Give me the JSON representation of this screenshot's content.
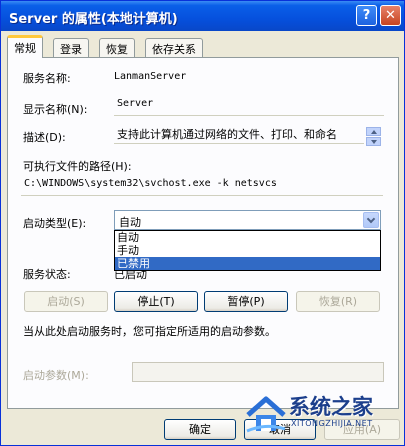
{
  "window": {
    "title": "Server 的属性(本地计算机)",
    "help_glyph": "?",
    "close_glyph": "✕"
  },
  "tabs": [
    {
      "label": "常规",
      "active": true
    },
    {
      "label": "登录",
      "active": false
    },
    {
      "label": "恢复",
      "active": false
    },
    {
      "label": "依存关系",
      "active": false
    }
  ],
  "general": {
    "service_name_label": "服务名称:",
    "service_name_value": "LanmanServer",
    "display_name_label": "显示名称(N):",
    "display_name_value": "Server",
    "description_label": "描述(D):",
    "description_value": "支持此计算机通过网络的文件、打印、和命名",
    "exe_path_label": "可执行文件的路径(H):",
    "exe_path_value": "C:\\WINDOWS\\system32\\svchost.exe -k netsvcs",
    "startup_type_label": "启动类型(E):",
    "startup_type_value": "自动",
    "startup_options": [
      "自动",
      "手动",
      "已禁用"
    ],
    "startup_highlighted": "已禁用",
    "service_status_label": "服务状态:",
    "service_status_value": "已启动",
    "start_button": "启动(S)",
    "stop_button": "停止(T)",
    "pause_button": "暂停(P)",
    "resume_button": "恢复(R)",
    "hint_text": "当从此处启动服务时，您可指定所适用的启动参数。",
    "start_params_label": "启动参数(M):",
    "start_params_value": ""
  },
  "footer": {
    "ok_button": "确定",
    "cancel_button": "取消",
    "apply_button": "应用(A)"
  },
  "watermark": {
    "text": "系统之家",
    "subtext": "XITONGZHIJIA.NET"
  },
  "colors": {
    "titlebar": "#0650dd",
    "selection": "#316ac5",
    "tab_highlight": "#ffc83c"
  }
}
